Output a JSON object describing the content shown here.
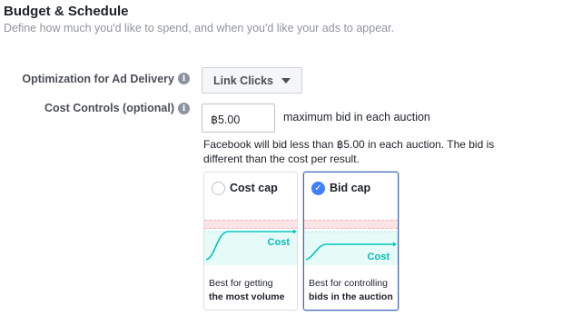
{
  "header": {
    "title": "Budget & Schedule",
    "subtitle": "Define how much you'd like to spend, and when you'd like your ads to appear."
  },
  "optimization": {
    "label": "Optimization for Ad Delivery",
    "info_icon": "info-icon",
    "value": "Link Clicks"
  },
  "cost_controls": {
    "label": "Cost Controls (optional)",
    "info_icon": "info-icon",
    "bid_value": "฿5.00",
    "bid_suffix": "maximum bid in each auction",
    "note": "Facebook will bid less than ฿5.00 in each auction. The bid is different than the cost per result."
  },
  "options": [
    {
      "title": "Cost cap",
      "selected": false,
      "chart_label": "Cost",
      "desc_line1": "Best for getting",
      "desc_line2": "the most volume"
    },
    {
      "title": "Bid cap",
      "selected": true,
      "chart_label": "Cost",
      "desc_line1": "Best for controlling",
      "desc_line2": "bids in the auction"
    }
  ],
  "colors": {
    "accent": "#4080ff",
    "selected_border": "#4267b2",
    "teal": "#00c7be",
    "teal_fill": "#e6faf8",
    "pink_band": "#fbe3e6"
  }
}
